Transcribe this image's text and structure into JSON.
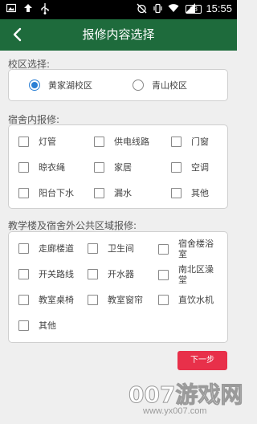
{
  "status_bar": {
    "icons": [
      "gallery-icon",
      "upload-icon",
      "usb-icon",
      "alarm-off-icon",
      "vibrate-icon",
      "wifi-icon",
      "signal-icon"
    ],
    "battery": "68",
    "time": "15:55"
  },
  "app_bar": {
    "title": "报修内容选择",
    "back_icon": "chevron-left-icon",
    "background": "#1e6b3c"
  },
  "campus": {
    "label": "校区选择:",
    "options": [
      {
        "label": "黄家湖校区",
        "selected": true
      },
      {
        "label": "青山校区",
        "selected": false
      }
    ]
  },
  "dorm": {
    "label": "宿舍内报修:",
    "items": [
      "灯管",
      "供电线路",
      "门窗",
      "晾衣绳",
      "家居",
      "空调",
      "阳台下水",
      "漏水",
      "其他"
    ]
  },
  "public": {
    "label": "教学楼及宿舍外公共区域报修:",
    "items": [
      "走廊楼道",
      "卫生间",
      "宿舍楼浴室",
      "开关路线",
      "开水器",
      "南北区澡堂",
      "教室桌椅",
      "教室窗帘",
      "直饮水机",
      "其他"
    ]
  },
  "next_button": {
    "label": "下一步",
    "color": "#e8304a"
  },
  "watermark": {
    "big": "007游戏网",
    "small": "www.yx007.com"
  }
}
